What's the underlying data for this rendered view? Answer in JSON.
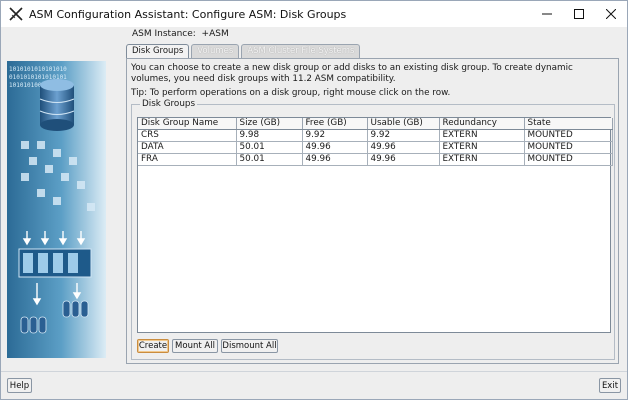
{
  "window": {
    "title": "ASM Configuration Assistant: Configure ASM: Disk Groups",
    "controls": [
      "minimize-icon",
      "maximize-icon",
      "close-icon"
    ]
  },
  "asm_instance": {
    "label": "ASM Instance:",
    "value": "+ASM"
  },
  "tabs": [
    {
      "label": "Disk Groups",
      "enabled": true
    },
    {
      "label": "Volumes",
      "enabled": false
    },
    {
      "label": "ASM Cluster File Systems",
      "enabled": false
    }
  ],
  "description": "You can choose to create a new disk group or add disks to an existing disk group. To create dynamic volumes, you need disk groups with 11.2 ASM compatibility.",
  "tip": "Tip: To perform operations on a disk group, right mouse click on the row.",
  "disk_groups": {
    "legend": "Disk Groups",
    "columns": [
      "Disk Group Name",
      "Size (GB)",
      "Free (GB)",
      "Usable (GB)",
      "Redundancy",
      "State"
    ],
    "rows": [
      [
        "CRS",
        "9.98",
        "9.92",
        "9.92",
        "EXTERN",
        "MOUNTED"
      ],
      [
        "DATA",
        "50.01",
        "49.96",
        "49.96",
        "EXTERN",
        "MOUNTED"
      ],
      [
        "FRA",
        "50.01",
        "49.96",
        "49.96",
        "EXTERN",
        "MOUNTED"
      ]
    ]
  },
  "buttons": {
    "create": "Create",
    "mount_all": "Mount All",
    "dismount_all": "Dismount All",
    "help": "Help",
    "exit": "Exit"
  },
  "side_image": {
    "binary_rows": [
      "1010101010101010",
      "0101010101010101",
      "1010101000101010"
    ]
  },
  "colors": {
    "accent_blue": "#2a6f9c",
    "focus_orange": "#c98c3f"
  }
}
